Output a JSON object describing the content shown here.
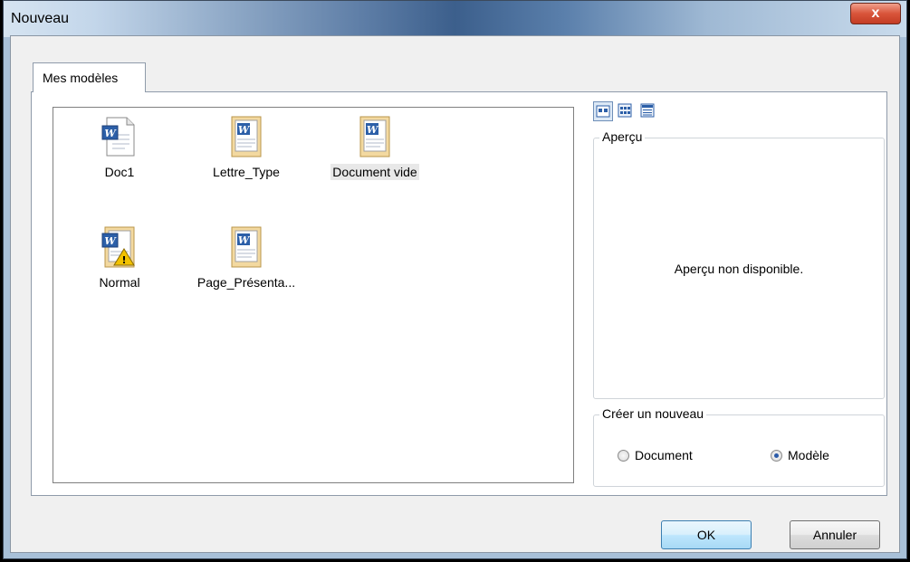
{
  "window": {
    "title": "Nouveau",
    "close_symbol": "x"
  },
  "tabs": [
    {
      "label": "Mes modèles",
      "active": true
    }
  ],
  "files": [
    {
      "name": "Doc1",
      "icon": "word-document-icon"
    },
    {
      "name": "Lettre_Type",
      "icon": "word-template-icon"
    },
    {
      "name": "Document vide",
      "icon": "word-template-icon",
      "selected": true
    },
    {
      "name": "Normal",
      "icon": "word-normal-template-icon"
    },
    {
      "name": "Page_Présenta...",
      "icon": "word-template-icon"
    }
  ],
  "view_buttons": [
    {
      "icon": "large-icons-view-icon",
      "active": true
    },
    {
      "icon": "list-view-icon",
      "active": false
    },
    {
      "icon": "details-view-icon",
      "active": false
    }
  ],
  "preview": {
    "title": "Aperçu",
    "message": "Aperçu non disponible."
  },
  "create_new": {
    "title": "Créer un nouveau",
    "options": [
      {
        "label": "Document",
        "selected": false
      },
      {
        "label": "Modèle",
        "selected": true
      }
    ]
  },
  "buttons": {
    "ok": "OK",
    "cancel": "Annuler"
  },
  "colors": {
    "accent": "#3c7fb1",
    "close": "#d9543a"
  }
}
